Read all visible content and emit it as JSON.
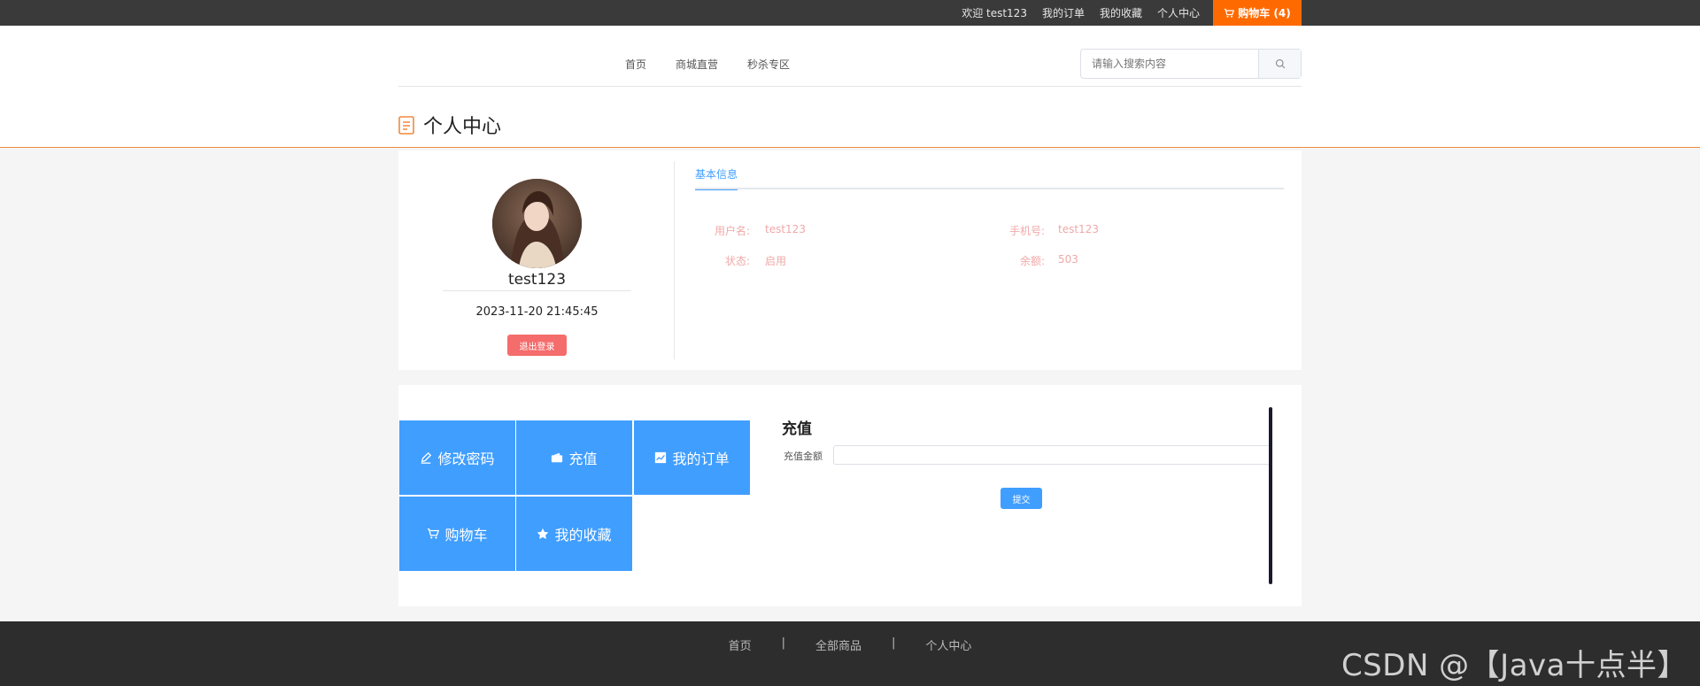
{
  "topbar": {
    "welcome": "欢迎 test123",
    "orders": "我的订单",
    "favorites": "我的收藏",
    "profile": "个人中心",
    "cart": "购物车 (4)"
  },
  "nav": {
    "items": [
      "首页",
      "商城直营",
      "秒杀专区"
    ],
    "search_placeholder": "请输入搜索内容"
  },
  "page": {
    "title": "个人中心"
  },
  "user": {
    "name": "test123",
    "time": "2023-11-20 21:45:45",
    "logout": "退出登录"
  },
  "info": {
    "tab": "基本信息",
    "fields": [
      {
        "label": "用户名:",
        "value": "test123"
      },
      {
        "label": "手机号:",
        "value": "test123"
      },
      {
        "label": "状态:",
        "value": "启用"
      },
      {
        "label": "余额:",
        "value": "503"
      }
    ]
  },
  "menu": {
    "tiles": [
      "修改密码",
      "充值",
      "我的订单",
      "购物车",
      "我的收藏"
    ]
  },
  "recharge": {
    "title": "充值",
    "amount_label": "充值金额",
    "amount_value": "",
    "submit": "提交"
  },
  "footer": {
    "links": [
      "首页",
      "|",
      "全部商品",
      "|",
      "个人中心"
    ],
    "watermark": "CSDN @【Java十点半】"
  },
  "colors": {
    "accent_orange": "#ff6a00",
    "primary_blue": "#409eff",
    "danger": "#f56c6c"
  }
}
